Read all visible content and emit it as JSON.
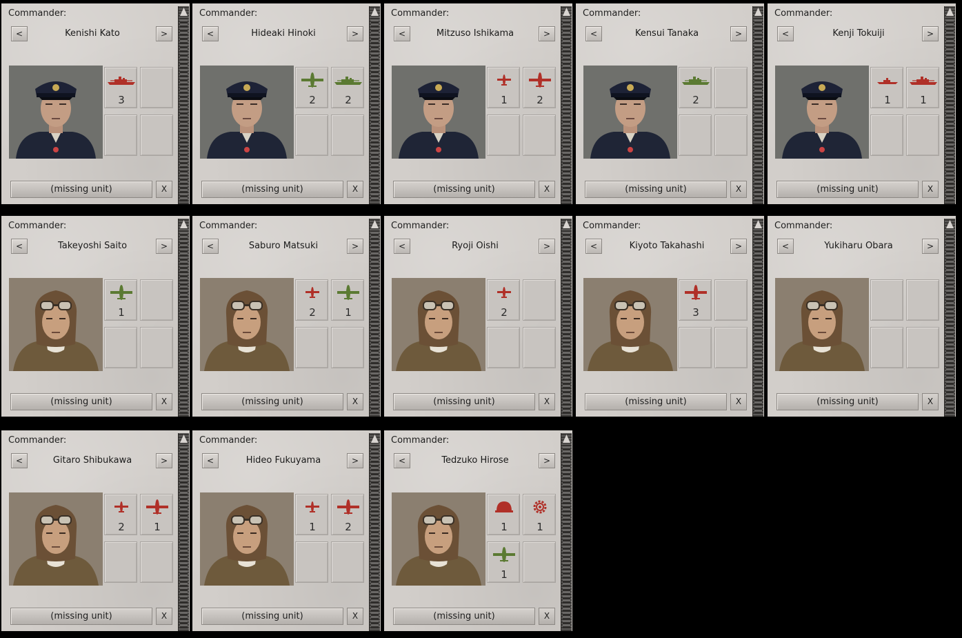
{
  "labels": {
    "commander": "Commander:",
    "missing_unit": "(missing unit)",
    "prev": "<",
    "next": ">",
    "remove": "X"
  },
  "commanders": [
    {
      "name": "Kenishi Kato",
      "portrait": "naval-officer",
      "units": [
        {
          "icon": "battleship-icon",
          "color": "#b03028",
          "count": "3"
        }
      ]
    },
    {
      "name": "Hideaki Hinoki",
      "portrait": "naval-officer",
      "units": [
        {
          "icon": "fighter-plane-icon",
          "color": "#5b7a32",
          "count": "2"
        },
        {
          "icon": "battleship-icon",
          "color": "#5b7a32",
          "count": "2"
        }
      ]
    },
    {
      "name": "Mitzuso Ishikama",
      "portrait": "naval-officer",
      "units": [
        {
          "icon": "small-plane-icon",
          "color": "#b03028",
          "count": "1"
        },
        {
          "icon": "fighter-plane-icon",
          "color": "#b03028",
          "count": "2"
        }
      ]
    },
    {
      "name": "Kensui Tanaka",
      "portrait": "naval-officer",
      "units": [
        {
          "icon": "battleship-icon",
          "color": "#5b7a32",
          "count": "2"
        }
      ]
    },
    {
      "name": "Kenji Tokuiji",
      "portrait": "naval-officer",
      "units": [
        {
          "icon": "small-ship-icon",
          "color": "#b03028",
          "count": "1"
        },
        {
          "icon": "battleship-icon",
          "color": "#b03028",
          "count": "1"
        }
      ]
    },
    {
      "name": "Takeyoshi Saito",
      "portrait": "pilot",
      "units": [
        {
          "icon": "fighter-plane-icon",
          "color": "#5b7a32",
          "count": "1"
        }
      ]
    },
    {
      "name": "Saburo Matsuki",
      "portrait": "pilot",
      "units": [
        {
          "icon": "small-plane-icon",
          "color": "#b03028",
          "count": "2"
        },
        {
          "icon": "fighter-plane-icon",
          "color": "#5b7a32",
          "count": "1"
        }
      ]
    },
    {
      "name": "Ryoji Oishi",
      "portrait": "pilot",
      "units": [
        {
          "icon": "small-plane-icon",
          "color": "#b03028",
          "count": "2"
        }
      ]
    },
    {
      "name": "Kiyoto Takahashi",
      "portrait": "pilot",
      "units": [
        {
          "icon": "fighter-plane-icon",
          "color": "#b03028",
          "count": "3"
        }
      ]
    },
    {
      "name": "Yukiharu Obara",
      "portrait": "pilot",
      "units": []
    },
    {
      "name": "Gitaro Shibukawa",
      "portrait": "pilot",
      "units": [
        {
          "icon": "small-plane-icon",
          "color": "#b03028",
          "count": "2"
        },
        {
          "icon": "fighter-plane-icon",
          "color": "#b03028",
          "count": "1"
        }
      ]
    },
    {
      "name": "Hideo Fukuyama",
      "portrait": "pilot",
      "units": [
        {
          "icon": "small-plane-icon",
          "color": "#b03028",
          "count": "1"
        },
        {
          "icon": "fighter-plane-icon",
          "color": "#b03028",
          "count": "2"
        }
      ]
    },
    {
      "name": "Tedzuko Hirose",
      "portrait": "pilot",
      "units": [
        {
          "icon": "helmet-icon",
          "color": "#b03028",
          "count": "1"
        },
        {
          "icon": "gear-icon",
          "color": "#b03028",
          "count": "1"
        },
        {
          "icon": "fighter-plane-icon",
          "color": "#5b7a32",
          "count": "1"
        }
      ]
    }
  ]
}
